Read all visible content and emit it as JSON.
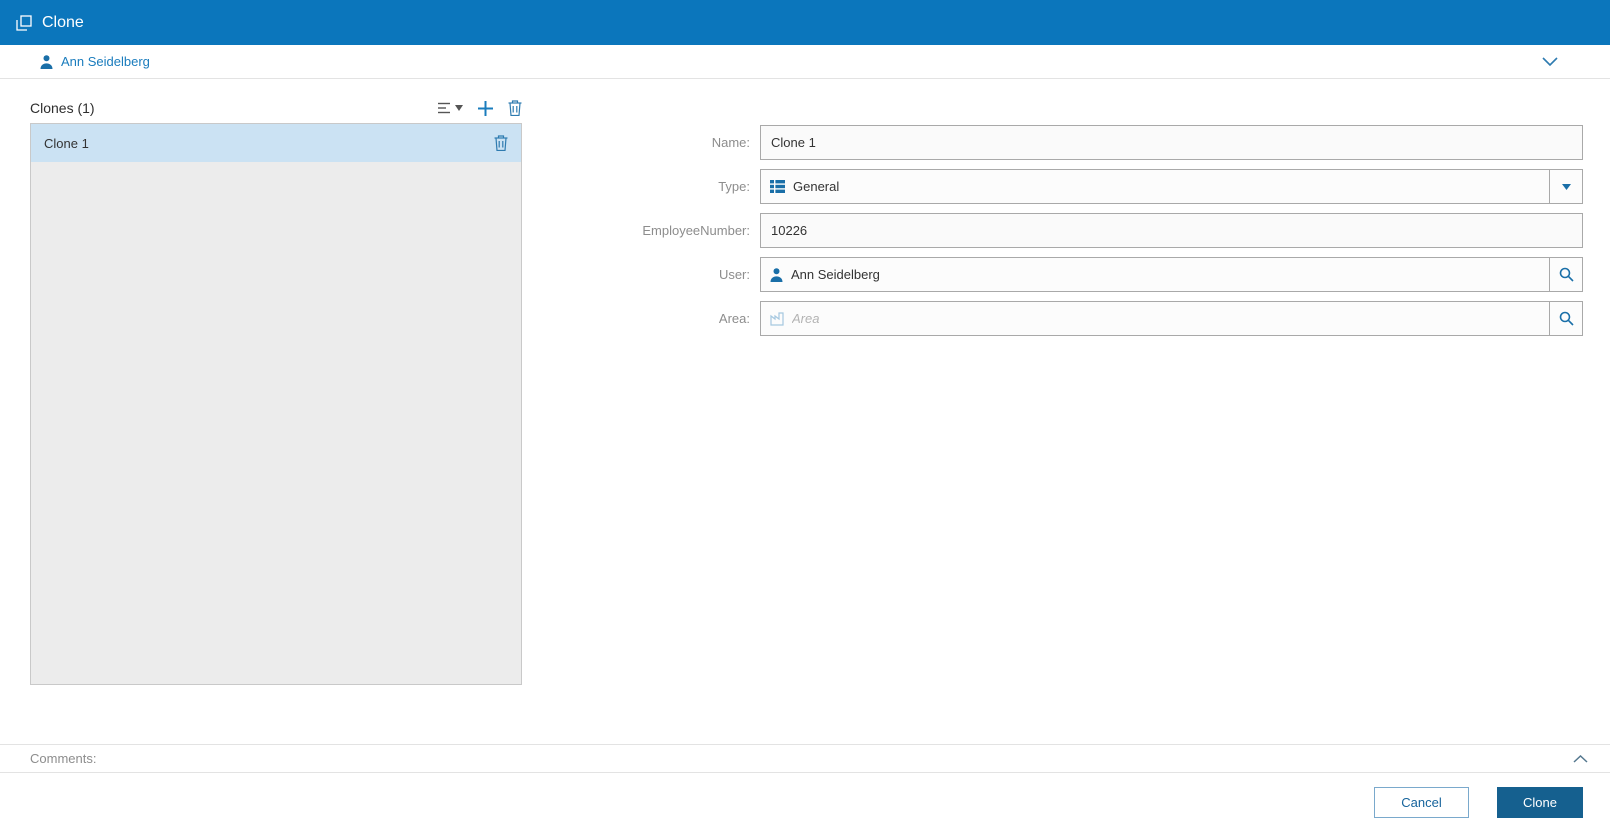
{
  "titlebar": {
    "title": "Clone"
  },
  "user_bar": {
    "user": "Ann Seidelberg"
  },
  "clones_panel": {
    "header": "Clones (1)",
    "items": [
      {
        "name": "Clone 1",
        "selected": true
      }
    ]
  },
  "form": {
    "name": {
      "label": "Name:",
      "value": "Clone 1"
    },
    "type": {
      "label": "Type:",
      "value": "General"
    },
    "employee_number": {
      "label": "EmployeeNumber:",
      "value": "10226"
    },
    "user": {
      "label": "User:",
      "value": "Ann Seidelberg"
    },
    "area": {
      "label": "Area:",
      "placeholder": "Area"
    }
  },
  "comments": {
    "label": "Comments:"
  },
  "footer": {
    "cancel_label": "Cancel",
    "clone_label": "Clone"
  },
  "icons": {
    "titlebar": "clone-icon",
    "user": "person-icon",
    "user_bar_collapse": "chevron-down-icon",
    "list_sort": "sort-icon",
    "list_add": "plus-icon",
    "list_delete": "trash-icon",
    "type_field": "list-icon",
    "type_dropdown": "caret-down-icon",
    "lookup": "magnifier-icon",
    "area_field": "building-icon",
    "comments_toggle": "chevron-up-icon"
  },
  "colors": {
    "titlebar_background": "#0b76bc",
    "accent_blue": "#1a7cbd",
    "selected_row": "#cbe2f3",
    "primary_button": "#15608f",
    "list_background": "#ececec",
    "border_gray": "#a9a9a9"
  }
}
